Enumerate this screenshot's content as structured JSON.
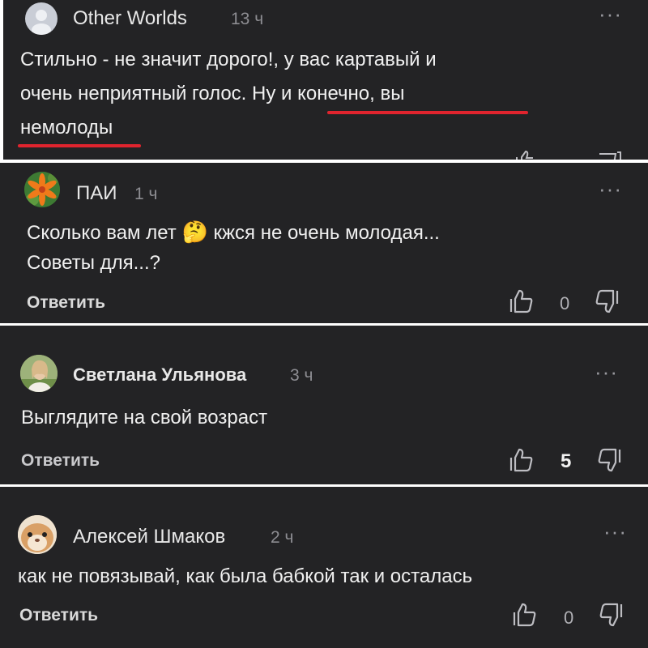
{
  "comments": [
    {
      "author": "Other Worlds",
      "time": "13 ч",
      "text_line1": "Стильно - не значит дорого!, у вас картавый и",
      "text_line2": "очень неприятный голос. Ну и конечно, вы",
      "text_line3": "немолоды",
      "more": "···",
      "highlight_color": "#e0242e"
    },
    {
      "author": "ПАИ",
      "time": "1 ч",
      "text_line1_a": "Сколько вам лет",
      "text_line1_emoji": "🤔",
      "text_line1_b": "кжся не очень молодая...",
      "text_line2": "Советы для...?",
      "reply": "Ответить",
      "likes": "0",
      "more": "···"
    },
    {
      "author": "Светлана Ульянова",
      "time": "3 ч",
      "text_line1": "Выглядите на свой возраст",
      "reply": "Ответить",
      "likes": "5",
      "more": "···"
    },
    {
      "author": "Алексей Шмаков",
      "time": "2 ч",
      "text_line1": "как не повязывай, как была бабкой так и осталась",
      "reply": "Ответить",
      "likes": "0",
      "more": "···"
    }
  ],
  "theme": {
    "card_bg": "#232325",
    "separator": "#ffffff",
    "text": "#f0f0f0",
    "muted": "#8d8d92"
  },
  "icons": [
    "avatar-placeholder-icon",
    "thumbs-up-icon",
    "thumbs-down-icon",
    "more-options-icon"
  ]
}
